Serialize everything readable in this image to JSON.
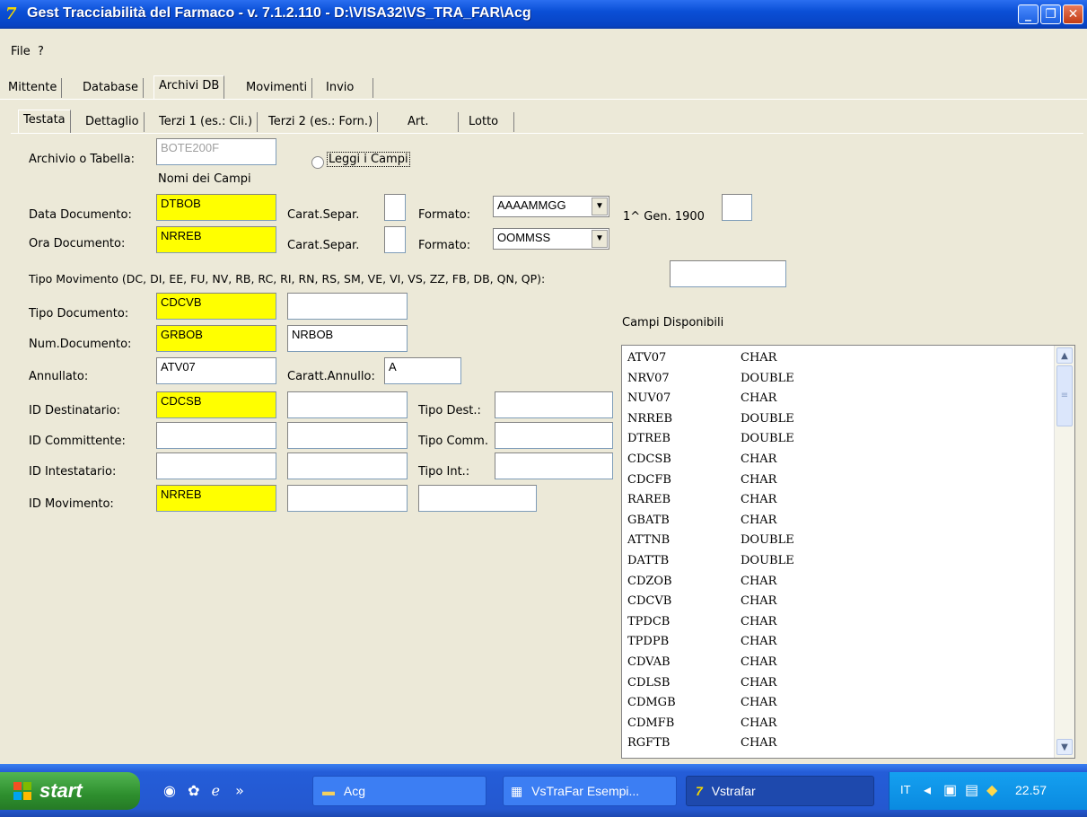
{
  "window": {
    "title": "Gest Tracciabilità del Farmaco - v. 7.1.2.110 - D:\\VISA32\\VS_TRA_FAR\\Acg"
  },
  "menu": {
    "file": "File",
    "help": "?"
  },
  "main_tabs": [
    "Mittente",
    "Database",
    "Archivi DB",
    "Movimenti",
    "Invio"
  ],
  "sub_tabs": [
    "Testata",
    "Dettaglio",
    "Terzi 1 (es.: Cli.)",
    "Terzi 2 (es.: Forn.)",
    "Art.",
    "Lotto"
  ],
  "form": {
    "archivio_label": "Archivio o Tabella:",
    "archivio_value": "BOTE200F",
    "leggi_campi": "Leggi i Campi",
    "nomi_campi": "Nomi dei Campi",
    "data_doc_label": "Data Documento:",
    "data_doc_value": "DTBOB",
    "carat_separ": "Carat.Separ.",
    "formato": "Formato:",
    "data_format": "AAAAMMGG",
    "gen1900": "1^ Gen. 1900",
    "ora_doc_label": "Ora Documento:",
    "ora_doc_value": "NRREB",
    "ora_format": "OOMMSS",
    "tipo_mov_label": "Tipo Movimento (DC, DI, EE, FU, NV, RB, RC, RI, RN, RS, SM, VE, VI, VS, ZZ, FB, DB, QN, QP):",
    "tipo_doc_label": "Tipo Documento:",
    "tipo_doc_value": "CDCVB",
    "num_doc_label": "Num.Documento:",
    "num_doc_value": "GRBOB",
    "num_doc_value2": "NRBOB",
    "annullato_label": "Annullato:",
    "annullato_value": "ATV07",
    "caratt_annullo": "Caratt.Annullo:",
    "caratt_annullo_value": "A",
    "id_dest_label": "ID Destinatario:",
    "id_dest_value": "CDCSB",
    "tipo_dest": "Tipo Dest.:",
    "id_comm_label": "ID Committente:",
    "tipo_comm": "Tipo Comm.",
    "id_int_label": "ID Intestatario:",
    "tipo_int": "Tipo Int.:",
    "id_mov_label": "ID Movimento:",
    "id_mov_value": "NRREB"
  },
  "campi": {
    "title": "Campi Disponibili",
    "rows": [
      [
        "ATV07",
        "CHAR"
      ],
      [
        "NRV07",
        "DOUBLE"
      ],
      [
        "NUV07",
        "CHAR"
      ],
      [
        "NRREB",
        "DOUBLE"
      ],
      [
        "DTREB",
        "DOUBLE"
      ],
      [
        "CDCSB",
        "CHAR"
      ],
      [
        "CDCFB",
        "CHAR"
      ],
      [
        "RAREB",
        "CHAR"
      ],
      [
        "GBATB",
        "CHAR"
      ],
      [
        "ATTNB",
        "DOUBLE"
      ],
      [
        "DATTB",
        "DOUBLE"
      ],
      [
        "CDZOB",
        "CHAR"
      ],
      [
        "CDCVB",
        "CHAR"
      ],
      [
        "TPDCB",
        "CHAR"
      ],
      [
        "TPDPB",
        "CHAR"
      ],
      [
        "CDVAB",
        "CHAR"
      ],
      [
        "CDLSB",
        "CHAR"
      ],
      [
        "CDMGB",
        "CHAR"
      ],
      [
        "CDMFB",
        "CHAR"
      ],
      [
        "RGFTB",
        "CHAR"
      ]
    ]
  },
  "taskbar": {
    "start": "start",
    "tasks": [
      "Acg",
      "VsTraFar Esempi...",
      "Vstrafar"
    ],
    "lang": "IT",
    "clock": "22.57"
  }
}
